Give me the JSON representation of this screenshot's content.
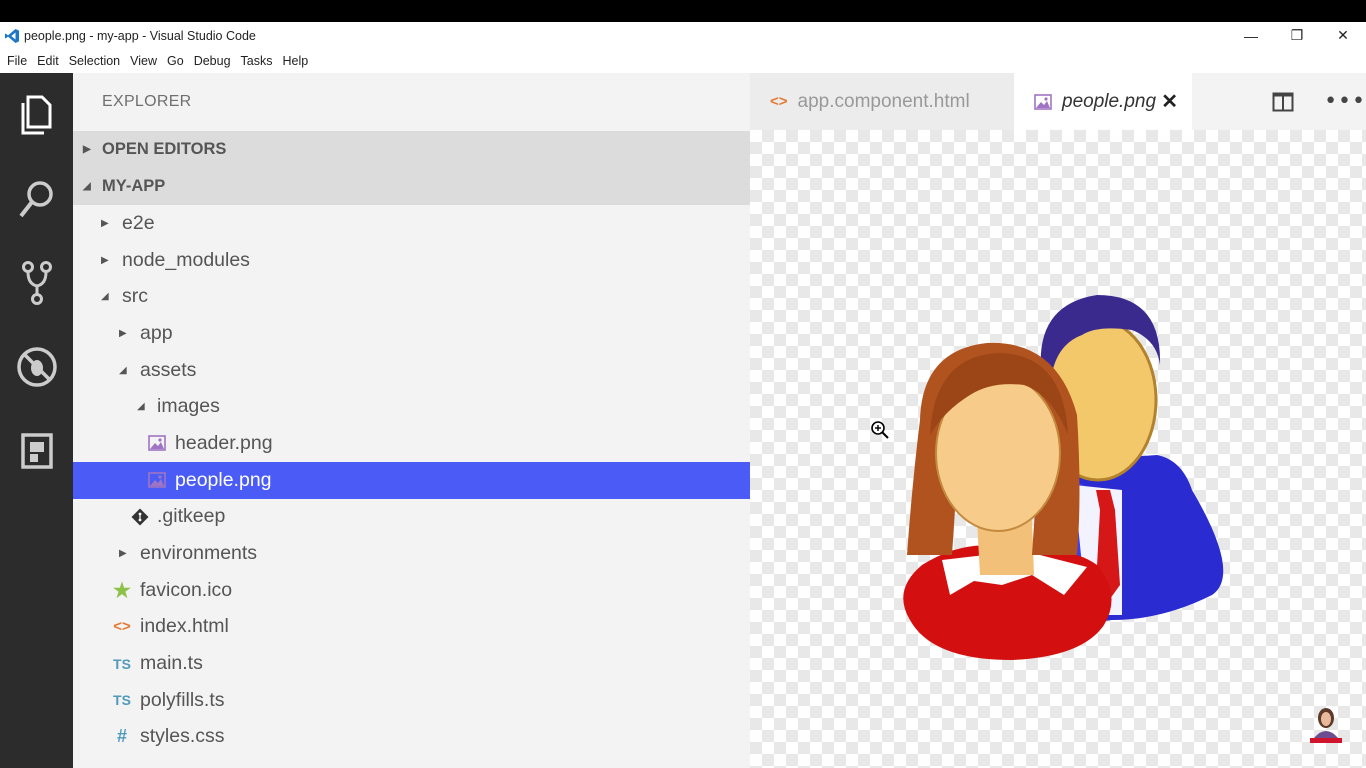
{
  "window": {
    "title": "people.png - my-app - Visual Studio Code",
    "controls": {
      "minimize": "—",
      "restore": "❐",
      "close": "✕"
    }
  },
  "menu": [
    "File",
    "Edit",
    "Selection",
    "View",
    "Go",
    "Debug",
    "Tasks",
    "Help"
  ],
  "activity_bar": [
    "files-icon",
    "search-icon",
    "source-control-icon",
    "debug-icon",
    "extensions-icon"
  ],
  "sidebar": {
    "header": "EXPLORER",
    "sections": {
      "open_editors": "OPEN EDITORS",
      "project": "MY-APP"
    },
    "tree": [
      {
        "label": "e2e",
        "type": "folder",
        "expanded": false
      },
      {
        "label": "node_modules",
        "type": "folder",
        "expanded": false
      },
      {
        "label": "src",
        "type": "folder",
        "expanded": true
      },
      {
        "label": "app",
        "type": "folder",
        "expanded": false
      },
      {
        "label": "assets",
        "type": "folder",
        "expanded": true
      },
      {
        "label": "images",
        "type": "folder",
        "expanded": true
      },
      {
        "label": "header.png",
        "type": "image"
      },
      {
        "label": "people.png",
        "type": "image",
        "selected": true
      },
      {
        "label": ".gitkeep",
        "type": "git"
      },
      {
        "label": "environments",
        "type": "folder",
        "expanded": false
      },
      {
        "label": "favicon.ico",
        "type": "favicon"
      },
      {
        "label": "index.html",
        "type": "html"
      },
      {
        "label": "main.ts",
        "type": "ts",
        "icon_text": "TS"
      },
      {
        "label": "polyfills.ts",
        "type": "ts",
        "icon_text": "TS"
      },
      {
        "label": "styles.css",
        "type": "css",
        "icon_text": "#"
      }
    ]
  },
  "tabs": [
    {
      "label": "app.component.html",
      "active": false
    },
    {
      "label": "people.png",
      "active": true,
      "close": "✕"
    }
  ],
  "colors": {
    "activity_bar": "#2c2c2c",
    "sidebar": "#f3f3f3",
    "selection": "#4b5cf6",
    "section_header": "#dcdcdc",
    "html_icon": "#e37933",
    "ts_icon": "#519aba",
    "favicon_icon": "#8dc149",
    "image_icon": "#a074c4"
  }
}
